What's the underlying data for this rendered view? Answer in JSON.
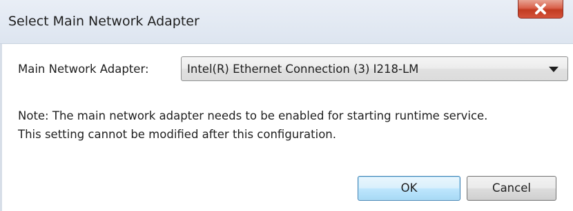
{
  "window": {
    "title": "Select Main Network Adapter",
    "close_icon": "close-icon"
  },
  "adapter": {
    "label": "Main Network Adapter:",
    "selected_value": "Intel(R) Ethernet Connection (3) I218-LM",
    "dropdown_icon": "chevron-down-icon"
  },
  "note": {
    "line1": "Note: The main network adapter needs to be enabled for starting runtime service.",
    "line2": "This setting cannot be modified after this configuration."
  },
  "buttons": {
    "ok_label": "OK",
    "cancel_label": "Cancel"
  },
  "colors": {
    "close_button": "#c23b22",
    "ok_button_border": "#3c7fb1"
  }
}
